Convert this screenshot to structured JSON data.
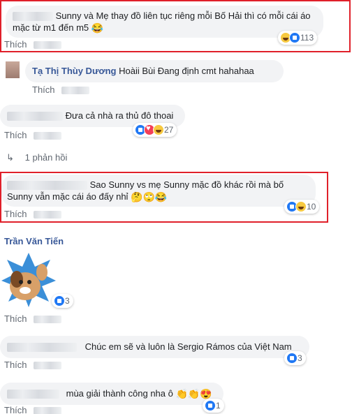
{
  "comments": [
    {
      "name": "",
      "text": "Sunny và Mẹ thay đồ liên tục riêng mỗi Bố Hải thì có mỗi cái áo mặc từ m1 đến m5",
      "emoji": "😂",
      "action": "Thích",
      "react_count": "113"
    },
    {
      "name": "Tạ Thị Thùy Dương",
      "text": "Hoàii Bùi Đang định cmt hahahaa",
      "action": "Thích"
    },
    {
      "name": "",
      "text": "Đưa cả nhà ra thủ đô thoai",
      "action": "Thích",
      "react_count": "27"
    },
    {
      "replies": "1 phản hồi"
    },
    {
      "name": "",
      "text": "Sao Sunny vs mẹ Sunny mặc đồ khác rồi mà bố Sunny vẫn mặc cái áo đấy nhỉ",
      "emoji": "🤔🙄😂",
      "action": "Thích",
      "react_count": "10"
    },
    {
      "name": "Trần Văn Tiến",
      "action": "Thích",
      "react_count": "3"
    },
    {
      "name": "",
      "text": "Chúc em sẽ và luôn là Sergio Rámos của Việt Nam",
      "action": "Thích",
      "react_count": "3"
    },
    {
      "name": "",
      "text": "mùa giải thành công nha ô",
      "emoji": "👏👏😍",
      "action": "Thích",
      "react_count": "1"
    }
  ],
  "colors": {
    "name": "#385898",
    "highlight": "#e0202a",
    "bubble": "#f2f3f5"
  }
}
